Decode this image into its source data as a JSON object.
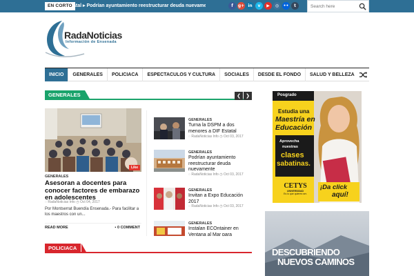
{
  "topbar": {
    "ticker_label": "EN CORTO",
    "ticker_text": "atal  ▸ Podrían ayuntamiento reestructurar deuda nuevame",
    "socials": [
      {
        "icon": "facebook-icon",
        "glyph": "f",
        "color": "#3b5998"
      },
      {
        "icon": "google-plus-icon",
        "glyph": "g+",
        "color": "#dd4b39"
      },
      {
        "icon": "linkedin-icon",
        "glyph": "in",
        "color": "#0e76a8"
      },
      {
        "icon": "vimeo-icon",
        "glyph": "v",
        "color": "#1ab7ea"
      },
      {
        "icon": "youtube-icon",
        "glyph": "▶",
        "color": "#e52d27"
      },
      {
        "icon": "instagram-icon",
        "glyph": "◎",
        "color": "#3f729b"
      },
      {
        "icon": "flickr-icon",
        "glyph": "••",
        "color": "#0063dc"
      },
      {
        "icon": "tumblr-icon",
        "glyph": "t",
        "color": "#35465c"
      }
    ],
    "search_placeholder": "Search here"
  },
  "logo": {
    "title": "RadaNoticias",
    "subtitle": "Información de Ensenada"
  },
  "nav": {
    "items": [
      "INICIO",
      "GENERALES",
      "POLICIACA",
      "ESPECTACULOS Y CULTURA",
      "SOCIALES",
      "DESDE EL FONDO",
      "SALUD Y BELLEZA"
    ]
  },
  "sections": {
    "generales": {
      "label": "GENERALES",
      "color": "#1aa36b"
    },
    "policiaca": {
      "label": "POLICIACA",
      "color": "#d8262d"
    }
  },
  "featured": {
    "category": "GENERALES",
    "title": "Asesoran a docentes para conocer factores de embarazo en adolescentes",
    "author": "RadaNoticias Info",
    "date": "Oct 04, 2017",
    "excerpt": "Por Montserrat Buendía Ensenada.- Para facilitar a los maestros  con un...",
    "read_more": "READ MORE",
    "comments": "0 COMMENT",
    "like": "Like"
  },
  "articles": [
    {
      "category": "GENERALES",
      "title": "Turna la DSPM a dos menores a DIF Estatal",
      "author": "RadaNoticias Info",
      "date": "Oct 03, 2017"
    },
    {
      "category": "GENERALES",
      "title": "Podrían ayuntamiento reestructurar deuda nuevamente",
      "author": "RadaNoticias Info",
      "date": "Oct 03, 2017"
    },
    {
      "category": "GENERALES",
      "title": "Invitan a Expo Educación 2017",
      "author": "RadaNoticias Info",
      "date": "Oct 03, 2017"
    },
    {
      "category": "GENERALES",
      "title": "Instalan ECOntainer en Ventana al Mar para",
      "author": "",
      "date": ""
    }
  ],
  "ad1": {
    "tag": "Posgrado",
    "line1": "Estudia una",
    "line2": "Maestría en",
    "line3": "Educación",
    "line4": "Aprovecha",
    "line5": "nuestras",
    "line6": "clases",
    "line7": "sabatinas.",
    "brand": "CETYS",
    "brand_sub": "UNIVERSIDAD",
    "brand_tag": "Es lo que quieres ser.",
    "cta1": "¡Da click",
    "cta2": "aquí!"
  },
  "ad2": {
    "line1": "DESCUBRIENDO",
    "line2": "NUEVOS CAMINOS"
  }
}
